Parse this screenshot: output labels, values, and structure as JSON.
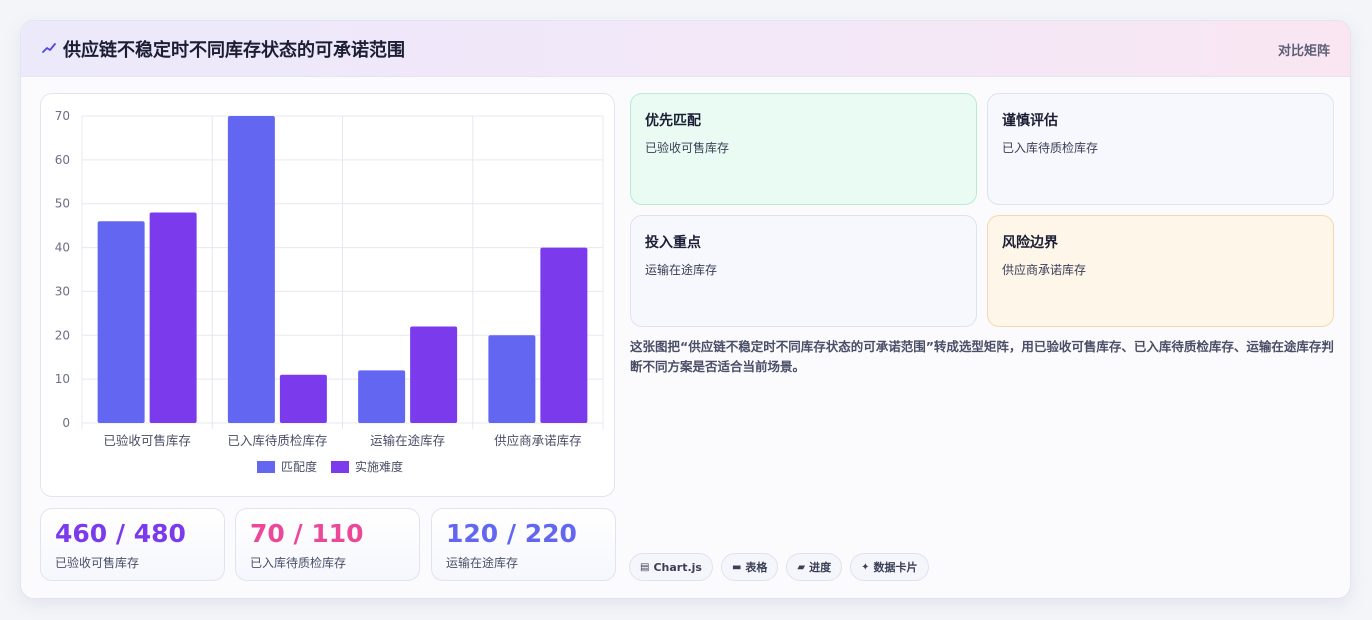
{
  "header": {
    "title": "供应链不稳定时不同库存状态的可承诺范围",
    "tag": "对比矩阵"
  },
  "colors": {
    "series_match": "#6366f1",
    "series_difficulty": "#7c3aed",
    "stat_purple": "#7c3aed",
    "stat_pink": "#ec4899",
    "stat_indigo": "#6366f1"
  },
  "chart_data": {
    "type": "bar",
    "categories": [
      "已验收可售库存",
      "已入库待质检库存",
      "运输在途库存",
      "供应商承诺库存"
    ],
    "series": [
      {
        "name": "匹配度",
        "values": [
          46,
          70,
          12,
          20
        ]
      },
      {
        "name": "实施难度",
        "values": [
          48,
          11,
          22,
          40
        ]
      }
    ],
    "ylim": [
      0,
      70
    ],
    "yticks": [
      0,
      10,
      20,
      30,
      40,
      50,
      60,
      70
    ],
    "grid": true,
    "legend": "bottom"
  },
  "stats": [
    {
      "value": "460 / 480",
      "label": "已验收可售库存"
    },
    {
      "value": "70 / 110",
      "label": "已入库待质检库存"
    },
    {
      "value": "120 / 220",
      "label": "运输在途库存"
    }
  ],
  "tiles": [
    {
      "title": "优先匹配",
      "sub": "已验收可售库存"
    },
    {
      "title": "谨慎评估",
      "sub": "已入库待质检库存"
    },
    {
      "title": "投入重点",
      "sub": "运输在途库存"
    },
    {
      "title": "风险边界",
      "sub": "供应商承诺库存"
    }
  ],
  "description": "这张图把“供应链不稳定时不同库存状态的可承诺范围”转成选型矩阵，用已验收可售库存、已入库待质检库存、运输在途库存判断不同方案是否适合当前场景。",
  "chips": [
    {
      "icon": "chart-icon",
      "label": "Chart.js"
    },
    {
      "icon": "table-icon",
      "label": "表格"
    },
    {
      "icon": "progress-icon",
      "label": "进度"
    },
    {
      "icon": "sparkle-icon",
      "label": "数据卡片"
    }
  ]
}
